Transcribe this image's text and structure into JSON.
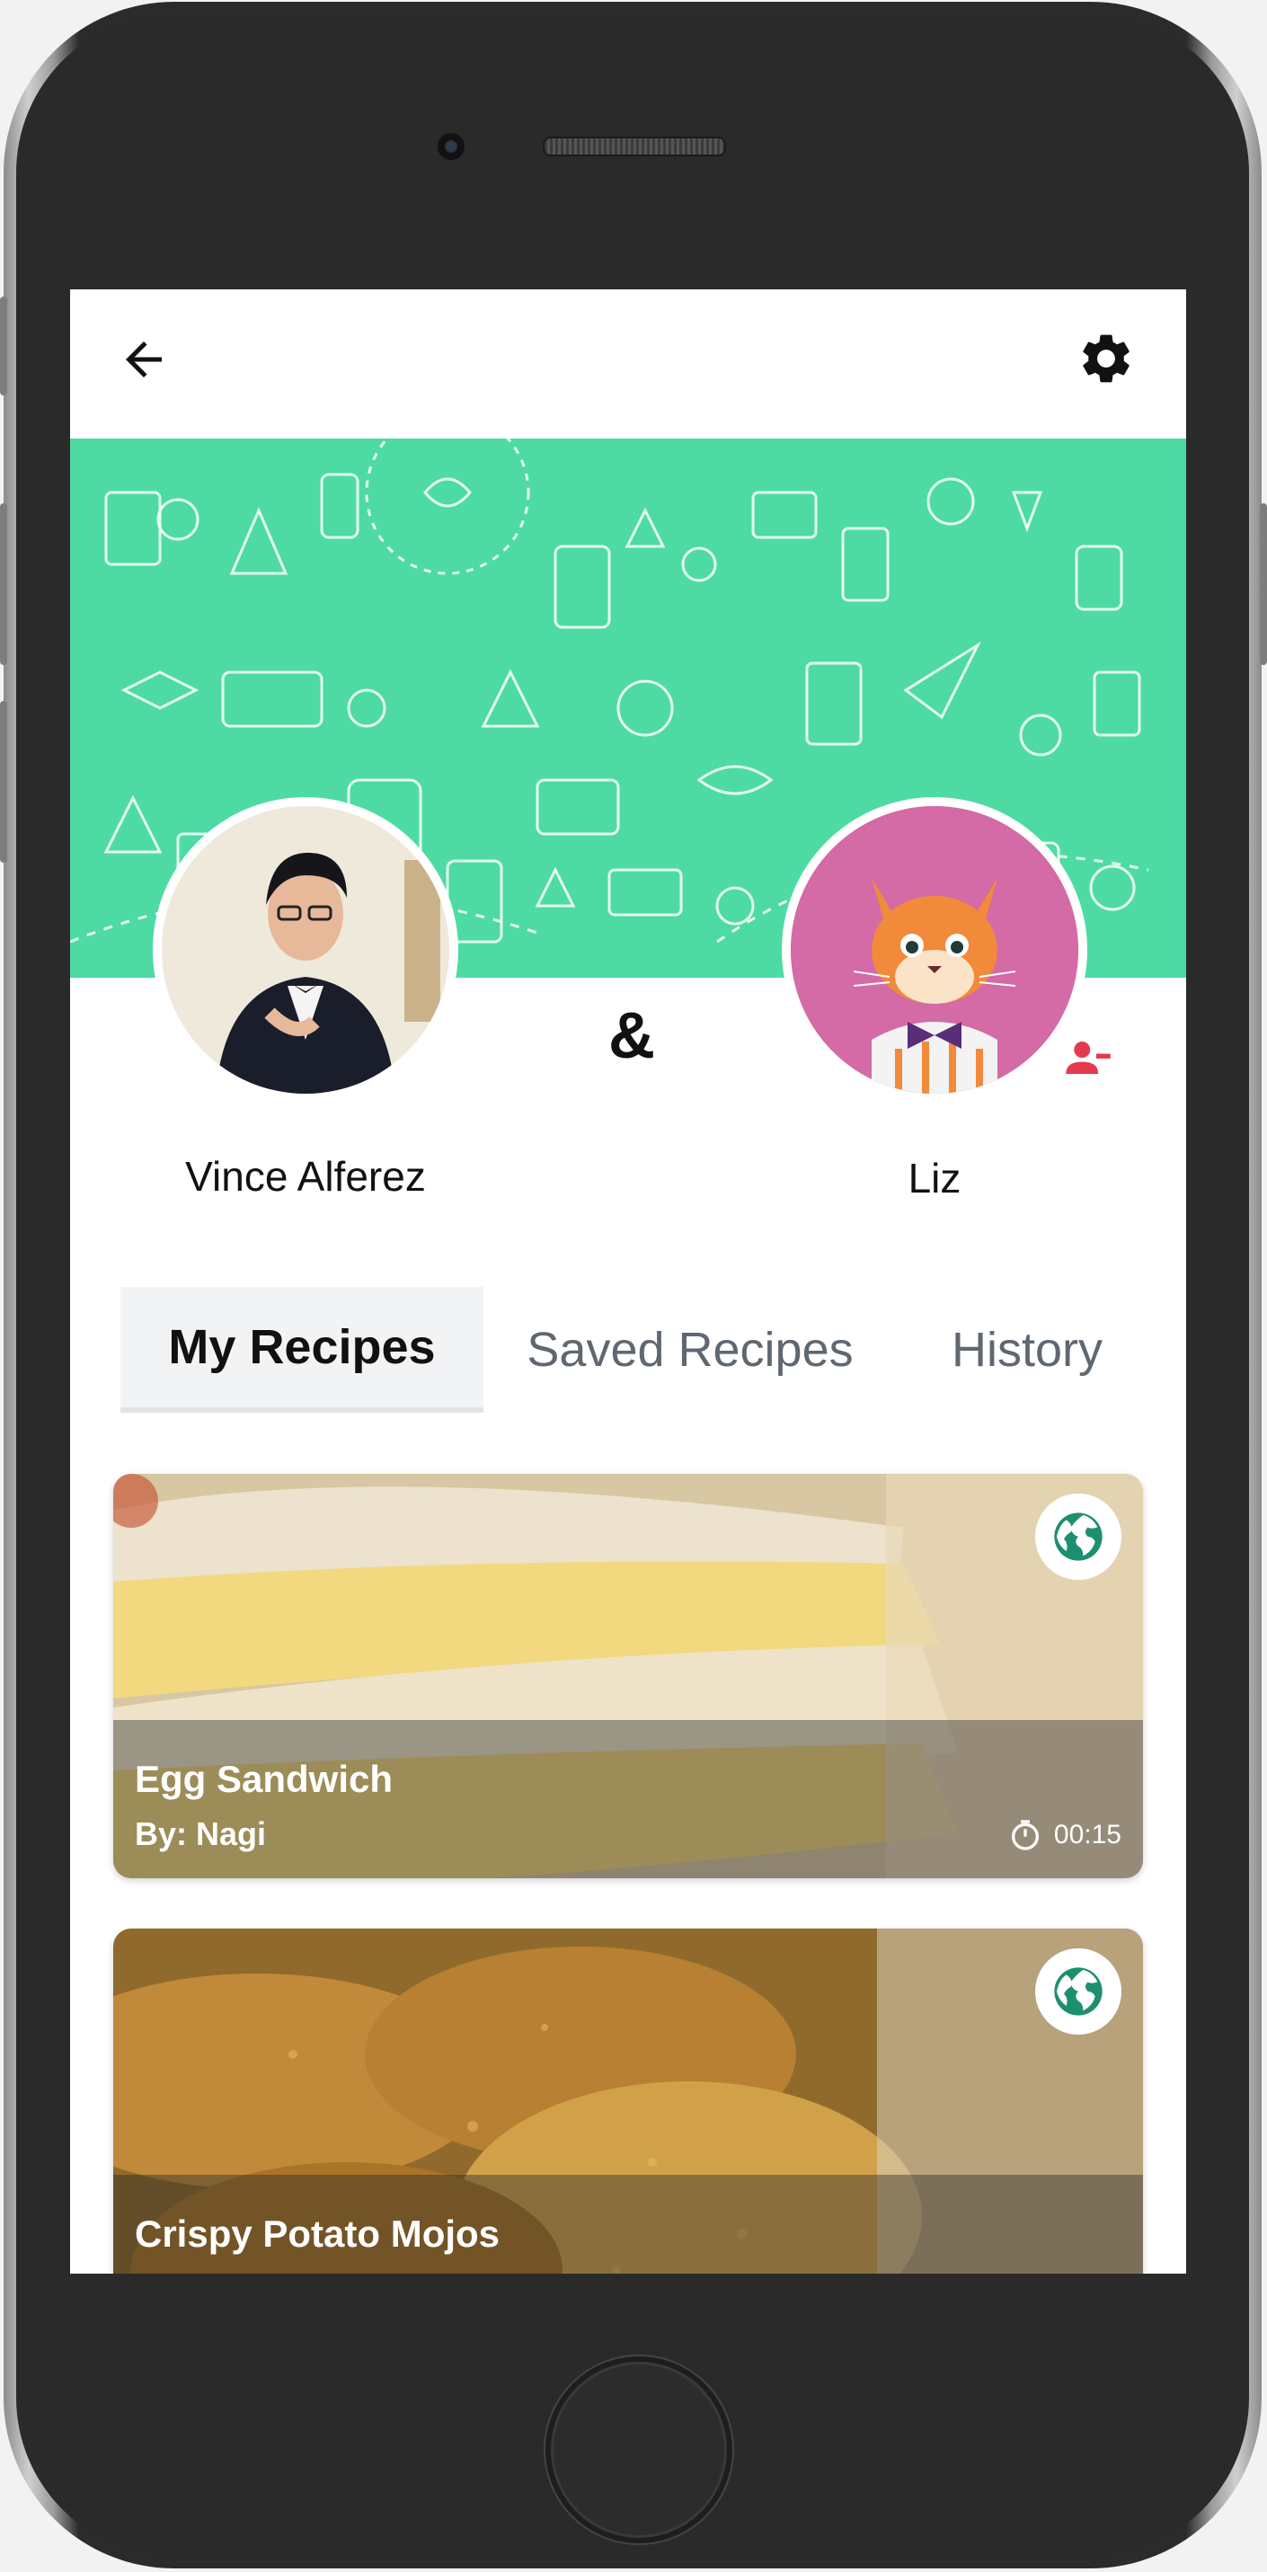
{
  "appbar": {
    "back_icon": "arrow-left-icon",
    "settings_icon": "gear-icon"
  },
  "profile": {
    "user_name": "Vince Alferez",
    "partner_name": "Liz",
    "ampersand": "&",
    "remove_partner_icon": "person-remove-icon"
  },
  "tabs": [
    {
      "label": "My Recipes",
      "active": true
    },
    {
      "label": "Saved Recipes",
      "active": false
    },
    {
      "label": "History",
      "active": false
    }
  ],
  "recipes": [
    {
      "title": "Egg Sandwich",
      "author": "By: Nagi",
      "time": "00:15",
      "visibility_icon": "globe-icon"
    },
    {
      "title": "Crispy Potato Mojos",
      "visibility_icon": "globe-icon"
    }
  ],
  "colors": {
    "banner": "#4edba3",
    "accent": "#1e8f6e",
    "danger": "#e53950"
  }
}
